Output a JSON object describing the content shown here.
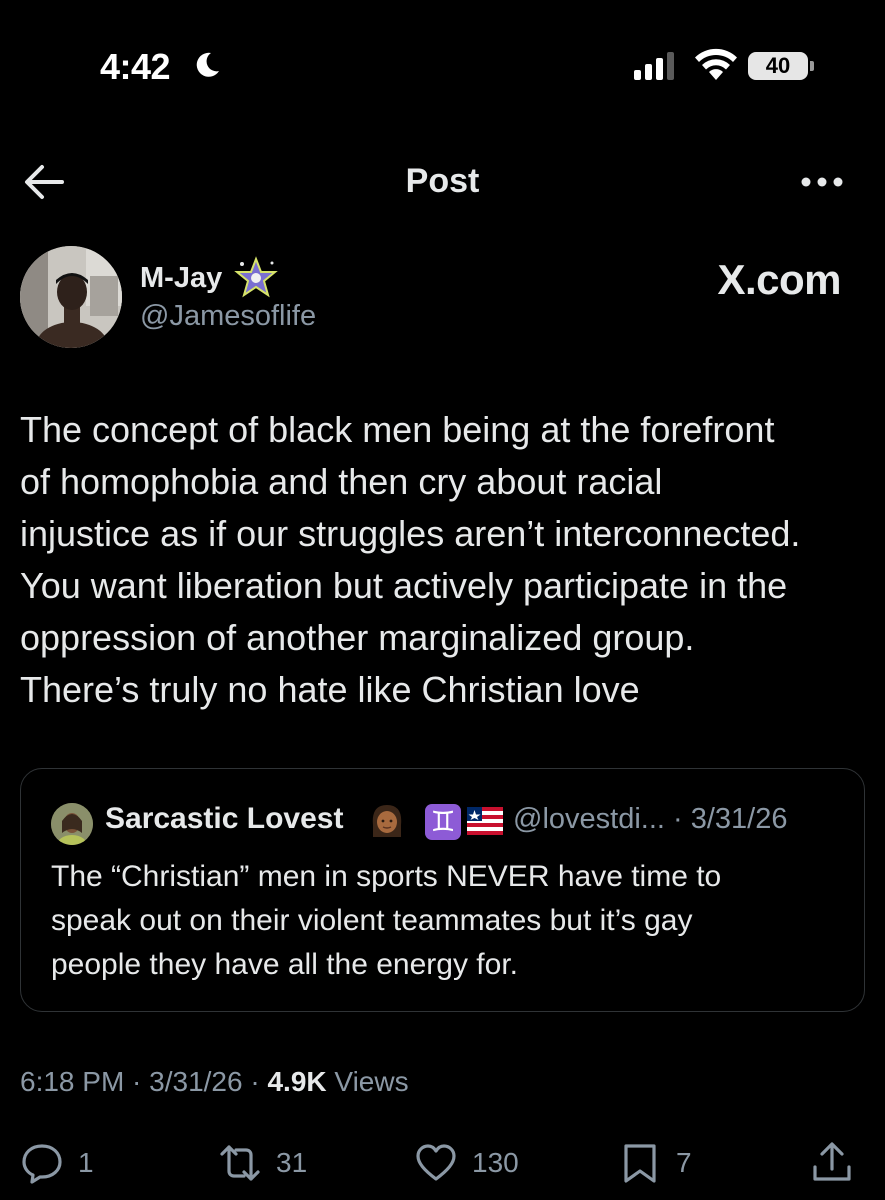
{
  "status_bar": {
    "time": "4:42",
    "battery": "40"
  },
  "header": {
    "title": "Post"
  },
  "author": {
    "display_name": "M-Jay",
    "handle": "@Jamesoflife",
    "watermark": "X.com"
  },
  "post": {
    "lines": [
      "The concept of black men being at the forefront",
      "of homophobia and then cry about racial",
      "injustice as if our struggles aren’t interconnected.",
      "You want liberation but actively participate in the",
      "oppression of another marginalized group.",
      "There’s truly no hate like Christian love"
    ]
  },
  "quote": {
    "display_name": "Sarcastic Lovest",
    "handle_date": "@lovestdi... · 3/31/26",
    "lines": [
      "The “Christian” men in sports NEVER have time to",
      "speak out on their violent teammates but it’s gay",
      "people they have all the energy for."
    ]
  },
  "meta": {
    "time_date": "6:18 PM · 3/31/26 · ",
    "views_count": "4.9K",
    "views_label": " Views"
  },
  "actions": {
    "replies": "1",
    "reposts": "31",
    "likes": "130",
    "bookmarks": "7"
  },
  "icons": {
    "status": [
      "moon-icon",
      "signal-icon",
      "wifi-icon",
      "battery-icon"
    ],
    "header": [
      "back-arrow-icon",
      "more-icon"
    ],
    "actions": [
      "reply-icon",
      "repost-icon",
      "like-icon",
      "bookmark-icon",
      "share-icon"
    ]
  },
  "colors": {
    "background": "#000000",
    "text": "#e7e9ea",
    "secondary_text": "#8b98a5",
    "border": "#2f3336"
  }
}
